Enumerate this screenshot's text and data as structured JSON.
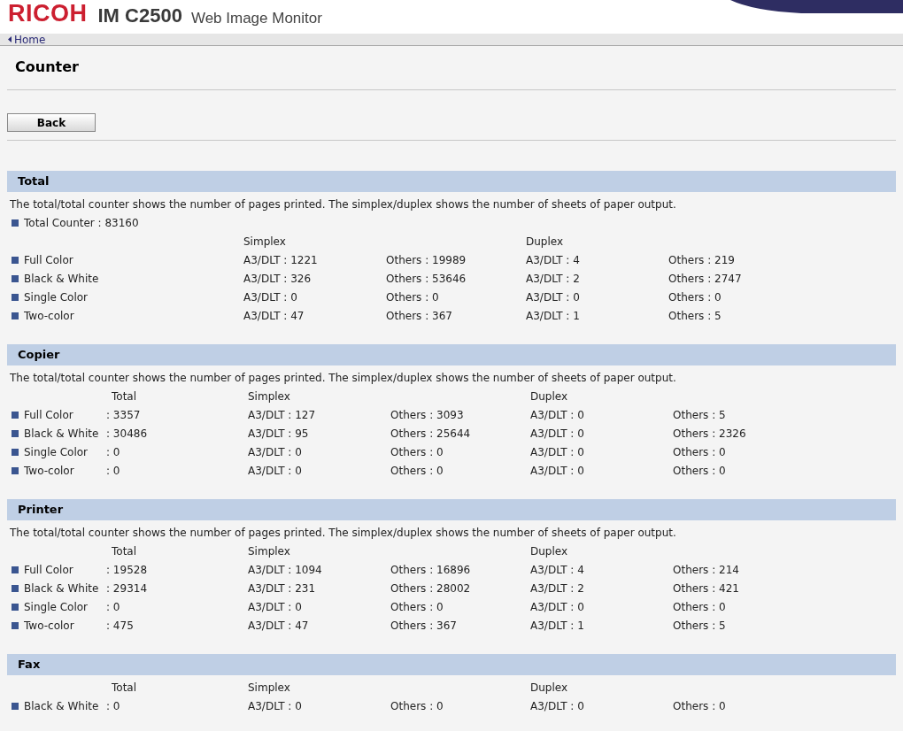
{
  "header": {
    "brand": "RICOH",
    "model": "IM C2500",
    "product": "Web Image Monitor"
  },
  "breadcrumb": {
    "home": "Home"
  },
  "page_title": "Counter",
  "back_button": "Back",
  "sections": [
    {
      "title": "Total",
      "description": "The total/total counter shows the number of pages printed. The simplex/duplex shows the number of sheets of paper output.",
      "total_counter": "Total Counter : 83160",
      "headers": {
        "simplex": "Simplex",
        "duplex": "Duplex"
      },
      "rows": [
        {
          "label": "Full Color",
          "simplex_a3": "A3/DLT : 1221",
          "simplex_others": "Others : 19989",
          "duplex_a3": "A3/DLT : 4",
          "duplex_others": "Others : 219"
        },
        {
          "label": "Black & White",
          "simplex_a3": "A3/DLT : 326",
          "simplex_others": "Others : 53646",
          "duplex_a3": "A3/DLT : 2",
          "duplex_others": "Others : 2747"
        },
        {
          "label": "Single Color",
          "simplex_a3": "A3/DLT : 0",
          "simplex_others": "Others : 0",
          "duplex_a3": "A3/DLT : 0",
          "duplex_others": "Others : 0"
        },
        {
          "label": "Two-color",
          "simplex_a3": "A3/DLT : 47",
          "simplex_others": "Others : 367",
          "duplex_a3": "A3/DLT : 1",
          "duplex_others": "Others : 5"
        }
      ]
    },
    {
      "title": "Copier",
      "description": "The total/total counter shows the number of pages printed. The simplex/duplex shows the number of sheets of paper output.",
      "headers": {
        "total": "Total",
        "simplex": "Simplex",
        "duplex": "Duplex"
      },
      "rows": [
        {
          "label": "Full Color",
          "total": ": 3357",
          "simplex_a3": "A3/DLT : 127",
          "simplex_others": "Others : 3093",
          "duplex_a3": "A3/DLT : 0",
          "duplex_others": "Others : 5"
        },
        {
          "label": "Black & White",
          "total": ": 30486",
          "simplex_a3": "A3/DLT : 95",
          "simplex_others": "Others : 25644",
          "duplex_a3": "A3/DLT : 0",
          "duplex_others": "Others : 2326"
        },
        {
          "label": "Single Color",
          "total": ": 0",
          "simplex_a3": "A3/DLT : 0",
          "simplex_others": "Others : 0",
          "duplex_a3": "A3/DLT : 0",
          "duplex_others": "Others : 0"
        },
        {
          "label": "Two-color",
          "total": ": 0",
          "simplex_a3": "A3/DLT : 0",
          "simplex_others": "Others : 0",
          "duplex_a3": "A3/DLT : 0",
          "duplex_others": "Others : 0"
        }
      ]
    },
    {
      "title": "Printer",
      "description": "The total/total counter shows the number of pages printed. The simplex/duplex shows the number of sheets of paper output.",
      "headers": {
        "total": "Total",
        "simplex": "Simplex",
        "duplex": "Duplex"
      },
      "rows": [
        {
          "label": "Full Color",
          "total": ": 19528",
          "simplex_a3": "A3/DLT : 1094",
          "simplex_others": "Others : 16896",
          "duplex_a3": "A3/DLT : 4",
          "duplex_others": "Others : 214"
        },
        {
          "label": "Black & White",
          "total": ": 29314",
          "simplex_a3": "A3/DLT : 231",
          "simplex_others": "Others : 28002",
          "duplex_a3": "A3/DLT : 2",
          "duplex_others": "Others : 421"
        },
        {
          "label": "Single Color",
          "total": ": 0",
          "simplex_a3": "A3/DLT : 0",
          "simplex_others": "Others : 0",
          "duplex_a3": "A3/DLT : 0",
          "duplex_others": "Others : 0"
        },
        {
          "label": "Two-color",
          "total": ": 475",
          "simplex_a3": "A3/DLT : 47",
          "simplex_others": "Others : 367",
          "duplex_a3": "A3/DLT : 1",
          "duplex_others": "Others : 5"
        }
      ]
    },
    {
      "title": "Fax",
      "headers": {
        "total": "Total",
        "simplex": "Simplex",
        "duplex": "Duplex"
      },
      "rows": [
        {
          "label": "Black & White",
          "total": ": 0",
          "simplex_a3": "A3/DLT : 0",
          "simplex_others": "Others : 0",
          "duplex_a3": "A3/DLT : 0",
          "duplex_others": "Others : 0"
        }
      ]
    }
  ]
}
